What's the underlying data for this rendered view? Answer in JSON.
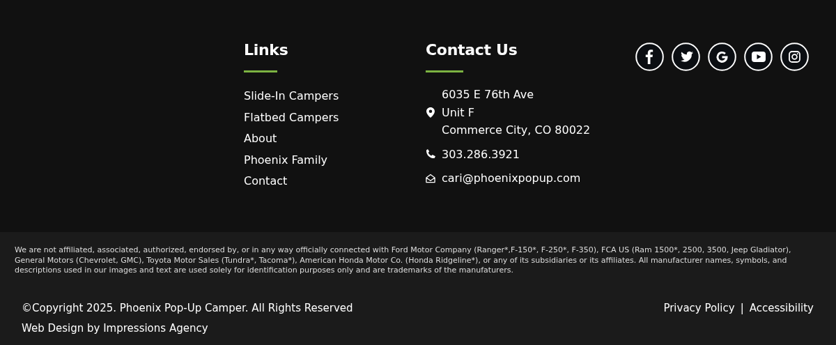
{
  "links": {
    "title": "Links",
    "items": [
      "Slide-In Campers",
      "Flatbed Campers",
      "About",
      "Phoenix Family",
      "Contact"
    ]
  },
  "contact": {
    "title": "Contact Us",
    "entries": [
      {
        "kind": "address",
        "lines": [
          "6035 E 76th Ave",
          "Unit F",
          "Commerce City, CO 80022"
        ]
      },
      {
        "kind": "phone",
        "lines": [
          "303.286.3921"
        ]
      },
      {
        "kind": "email",
        "lines": [
          "cari@phoenixpopup.com"
        ]
      }
    ]
  },
  "social": [
    {
      "kind": "facebook"
    },
    {
      "kind": "twitter"
    },
    {
      "kind": "google"
    },
    {
      "kind": "youtube"
    },
    {
      "kind": "instagram"
    }
  ],
  "disclaimer": "We are not affiliated, associated, authorized, endorsed by, or in any way officially connected with Ford Motor Company (Ranger*,F-150*, F-250*, F-350), FCA US (Ram 1500*, 2500, 3500, Jeep Gladiator), General Motors (Chevrolet, GMC), Toyota Motor Sales (Tundra*, Tacoma*), American Honda Motor Co. (Honda Ridgeline*), or any of its subsidiaries or its affiliates. All manufacturer names, symbols, and descriptions used in our images and text are used solely for identification purposes only and are trademarks of the manufaturers.",
  "copyright": "©Copyright 2025. Phoenix Pop-Up Camper. All Rights Reserved",
  "credit": "Web Design by Impressions Agency",
  "legal_links": [
    "Privacy Policy",
    "Accessibility"
  ],
  "separator": "|"
}
